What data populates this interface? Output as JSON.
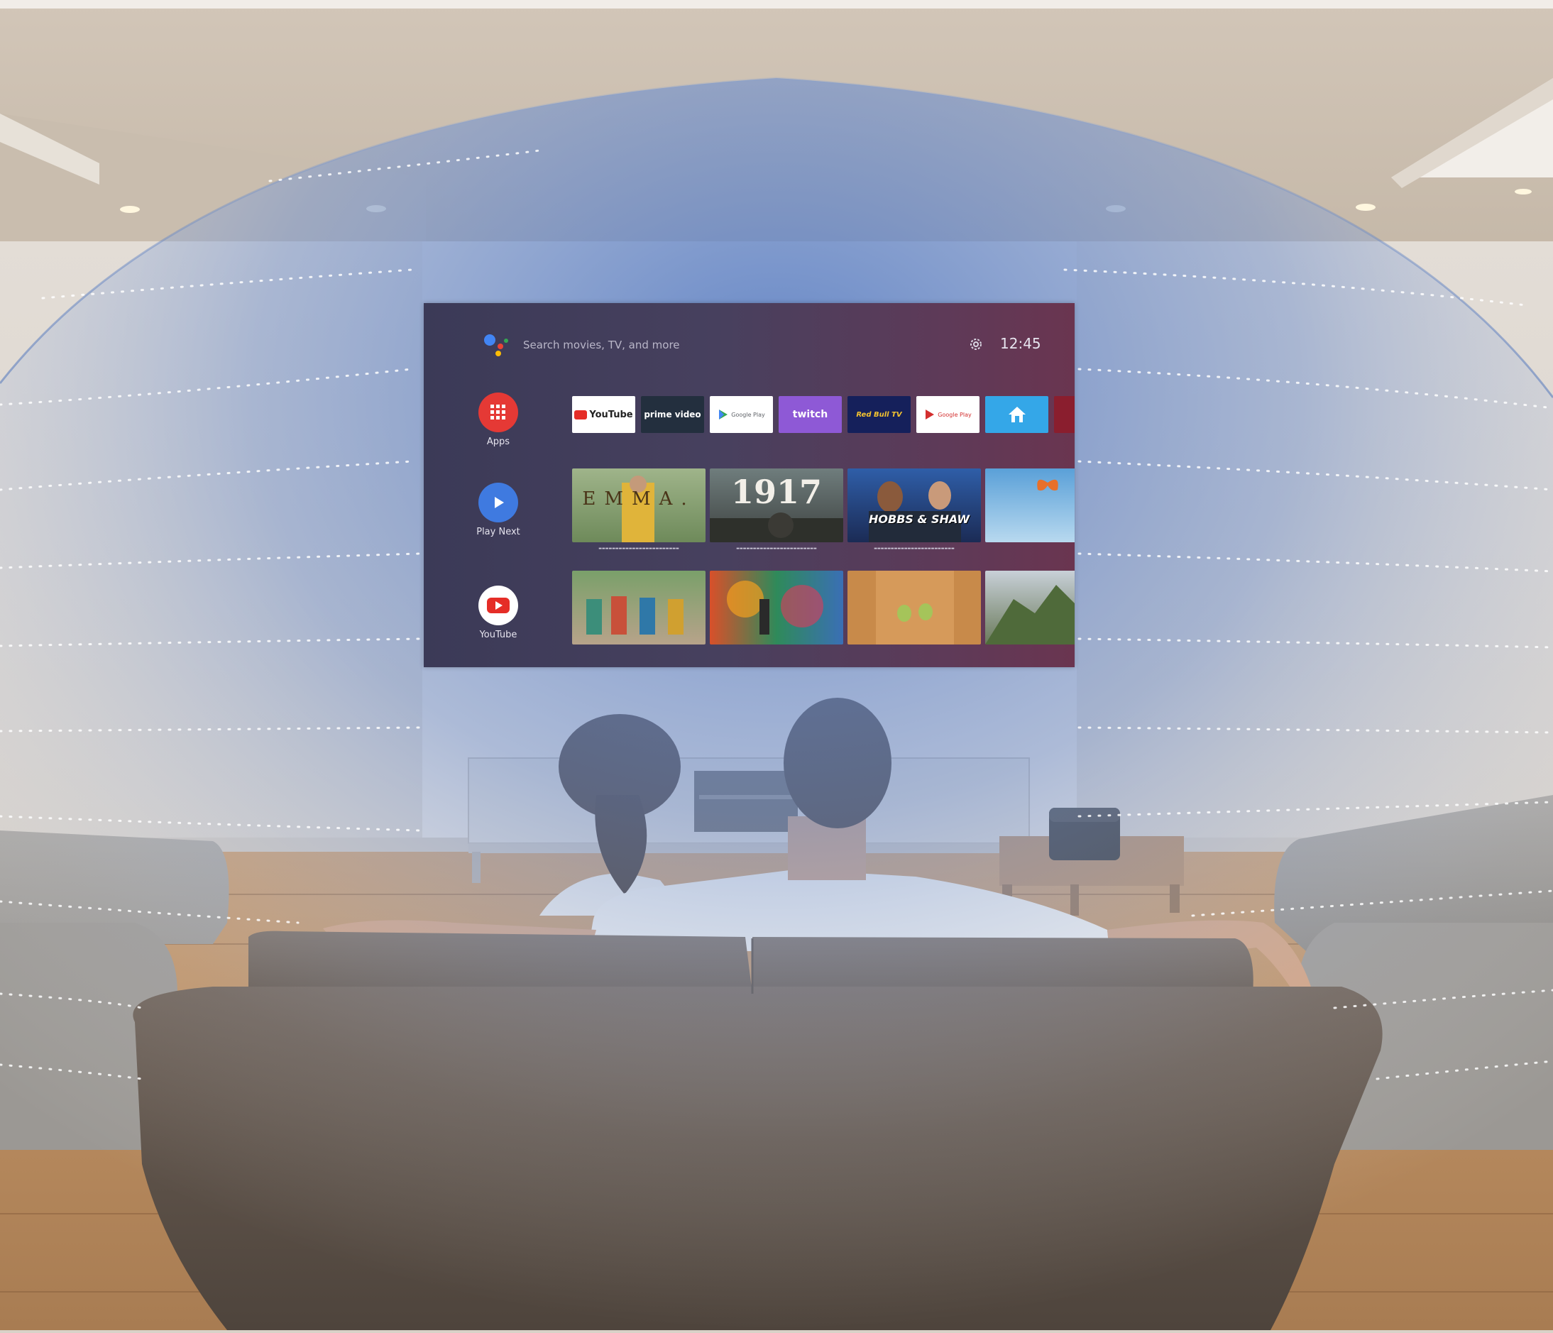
{
  "tv": {
    "search_placeholder": "Search movies, TV, and more",
    "clock": "12:45",
    "side_menu": [
      {
        "label": "Apps",
        "icon": "apps-grid-icon",
        "color": "#e53935"
      },
      {
        "label": "Play Next",
        "icon": "play-icon",
        "color": "#3f7ae0"
      },
      {
        "label": "YouTube",
        "icon": "youtube-icon",
        "color": "#ffffff"
      }
    ],
    "apps_row": [
      {
        "label": "YouTube",
        "bg": "#ffffff",
        "fg": "#e52d27"
      },
      {
        "label": "prime video",
        "bg": "#232f3e",
        "fg": "#ffffff"
      },
      {
        "label": "Google Play",
        "bg": "#ffffff",
        "fg": "#5f6368"
      },
      {
        "label": "twitch",
        "bg": "#8e59d6",
        "fg": "#ffffff"
      },
      {
        "label": "Red Bull TV",
        "bg": "#15205b",
        "fg": "#f2c230"
      },
      {
        "label": "Google Play",
        "bg": "#ffffff",
        "fg": "#d32f2f"
      },
      {
        "label": "",
        "bg": "#34a7e8",
        "fg": "#ffffff"
      }
    ],
    "movies_row": [
      {
        "title": "EMMA."
      },
      {
        "title": "1917"
      },
      {
        "title": "HOBBS & SHAW"
      },
      {
        "title": ""
      }
    ],
    "videos_row": [
      {
        "title": ""
      },
      {
        "title": ""
      },
      {
        "title": ""
      },
      {
        "title": ""
      }
    ]
  },
  "colors": {
    "dome_blue": "#5d82c6",
    "tv_left": "#3b3a57",
    "tv_right": "#6a3550",
    "sofa": "#6e6156",
    "floor": "#b88b5f"
  }
}
